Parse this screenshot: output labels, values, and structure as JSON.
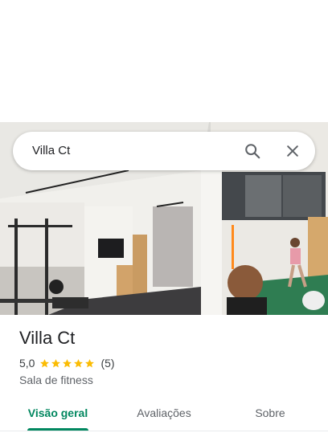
{
  "search": {
    "value": "Villa Ct",
    "search_icon": "search-icon",
    "close_icon": "close-icon"
  },
  "place": {
    "title": "Villa Ct",
    "rating": "5,0",
    "stars": 5,
    "review_count": "(5)",
    "category": "Sala de fitness"
  },
  "tabs": [
    {
      "label": "Visão geral",
      "active": true
    },
    {
      "label": "Avaliações",
      "active": false
    },
    {
      "label": "Sobre",
      "active": false
    }
  ],
  "colors": {
    "accent": "#01875f",
    "star": "#fbbc04"
  }
}
